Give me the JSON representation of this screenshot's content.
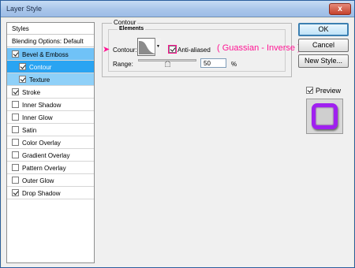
{
  "window": {
    "title": "Layer Style",
    "close_glyph": "x"
  },
  "styles_panel": {
    "header": "Styles",
    "blending_options": "Blending Options: Default",
    "items": [
      {
        "label": "Bevel & Emboss",
        "checked": true
      },
      {
        "label": "Contour",
        "checked": true
      },
      {
        "label": "Texture",
        "checked": true
      },
      {
        "label": "Stroke",
        "checked": true
      },
      {
        "label": "Inner Shadow",
        "checked": false
      },
      {
        "label": "Inner Glow",
        "checked": false
      },
      {
        "label": "Satin",
        "checked": false
      },
      {
        "label": "Color Overlay",
        "checked": false
      },
      {
        "label": "Gradient Overlay",
        "checked": false
      },
      {
        "label": "Pattern Overlay",
        "checked": false
      },
      {
        "label": "Outer Glow",
        "checked": false
      },
      {
        "label": "Drop Shadow",
        "checked": true
      }
    ]
  },
  "contour_panel": {
    "group_title": "Contour",
    "subgroup_title": "Elements",
    "contour_label": "Contour:",
    "anti_aliased_label": "Anti-aliased",
    "anti_aliased_checked": true,
    "annotation": "( Guassian - Inverse )",
    "range_label": "Range:",
    "range_value": "50",
    "range_unit": "%",
    "range_fraction": 0.5
  },
  "buttons": {
    "ok": "OK",
    "cancel": "Cancel",
    "new_style": "New Style..."
  },
  "preview": {
    "label": "Preview",
    "checked": true
  },
  "colors": {
    "selection": "#2aa4f2",
    "annotation": "#ff1493",
    "preview_stroke": "#a020f0"
  },
  "icons": {
    "pointer": "arrow-right-icon",
    "dropdown": "triangle-down-icon",
    "close": "x-icon"
  }
}
